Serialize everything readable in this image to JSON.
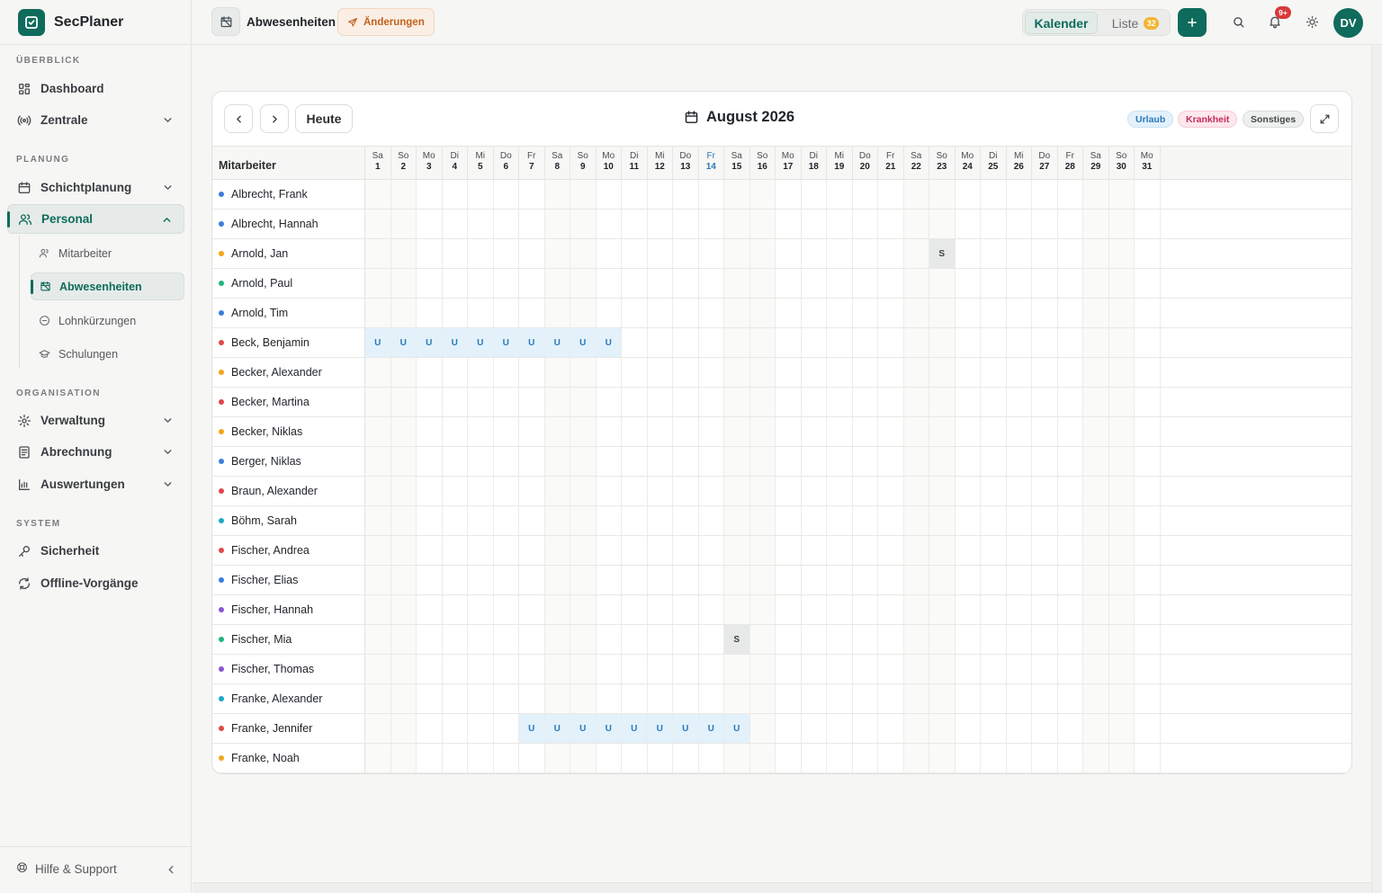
{
  "app": {
    "name": "SecPlaner",
    "help_label": "Hilfe & Support"
  },
  "sidebar": {
    "sections": {
      "overview": "ÜBERBLICK",
      "planning": "PLANUNG",
      "organization": "ORGANISATION",
      "system": "SYSTEM"
    },
    "items": {
      "dashboard": "Dashboard",
      "zentrale": "Zentrale",
      "schichtplanung": "Schichtplanung",
      "personal": "Personal",
      "verwaltung": "Verwaltung",
      "abrechnung": "Abrechnung",
      "auswertungen": "Auswertungen",
      "sicherheit": "Sicherheit",
      "offline": "Offline-Vorgänge"
    },
    "sub_items": {
      "mitarbeiter": "Mitarbeiter",
      "abwesenheiten": "Abwesenheiten",
      "lohnkuerzungen": "Lohnkürzungen",
      "schulungen": "Schulungen"
    }
  },
  "topbar": {
    "page_title": "Abwesenheiten",
    "changes_label": "Änderungen",
    "view_calendar": "Kalender",
    "view_list": "Liste",
    "list_count": "32",
    "notifications_badge": "9+",
    "avatar_initials": "DV"
  },
  "calendar": {
    "today_label": "Heute",
    "month_title": "August 2026",
    "legend": {
      "urlaub": "Urlaub",
      "krankheit": "Krankheit",
      "sonstiges": "Sonstiges"
    },
    "employee_col_label": "Mitarbeiter",
    "today_index": 13,
    "days": [
      {
        "name": "Sa",
        "num": "1",
        "weekend": true
      },
      {
        "name": "So",
        "num": "2",
        "weekend": true
      },
      {
        "name": "Mo",
        "num": "3",
        "weekend": false
      },
      {
        "name": "Di",
        "num": "4",
        "weekend": false
      },
      {
        "name": "Mi",
        "num": "5",
        "weekend": false
      },
      {
        "name": "Do",
        "num": "6",
        "weekend": false
      },
      {
        "name": "Fr",
        "num": "7",
        "weekend": false
      },
      {
        "name": "Sa",
        "num": "8",
        "weekend": true
      },
      {
        "name": "So",
        "num": "9",
        "weekend": true
      },
      {
        "name": "Mo",
        "num": "10",
        "weekend": false
      },
      {
        "name": "Di",
        "num": "11",
        "weekend": false
      },
      {
        "name": "Mi",
        "num": "12",
        "weekend": false
      },
      {
        "name": "Do",
        "num": "13",
        "weekend": false
      },
      {
        "name": "Fr",
        "num": "14",
        "weekend": false
      },
      {
        "name": "Sa",
        "num": "15",
        "weekend": true
      },
      {
        "name": "So",
        "num": "16",
        "weekend": true
      },
      {
        "name": "Mo",
        "num": "17",
        "weekend": false
      },
      {
        "name": "Di",
        "num": "18",
        "weekend": false
      },
      {
        "name": "Mi",
        "num": "19",
        "weekend": false
      },
      {
        "name": "Do",
        "num": "20",
        "weekend": false
      },
      {
        "name": "Fr",
        "num": "21",
        "weekend": false
      },
      {
        "name": "Sa",
        "num": "22",
        "weekend": true
      },
      {
        "name": "So",
        "num": "23",
        "weekend": true
      },
      {
        "name": "Mo",
        "num": "24",
        "weekend": false
      },
      {
        "name": "Di",
        "num": "25",
        "weekend": false
      },
      {
        "name": "Mi",
        "num": "26",
        "weekend": false
      },
      {
        "name": "Do",
        "num": "27",
        "weekend": false
      },
      {
        "name": "Fr",
        "num": "28",
        "weekend": false
      },
      {
        "name": "Sa",
        "num": "29",
        "weekend": true
      },
      {
        "name": "So",
        "num": "30",
        "weekend": true
      },
      {
        "name": "Mo",
        "num": "31",
        "weekend": false
      }
    ],
    "employees": [
      {
        "name": "Albrecht, Frank",
        "color": "#3b7ddd",
        "absences": {}
      },
      {
        "name": "Albrecht, Hannah",
        "color": "#3b7ddd",
        "absences": {}
      },
      {
        "name": "Arnold, Jan",
        "color": "#f2a51a",
        "absences": {
          "23": "S"
        }
      },
      {
        "name": "Arnold, Paul",
        "color": "#1fb57a",
        "absences": {}
      },
      {
        "name": "Arnold, Tim",
        "color": "#3b7ddd",
        "absences": {}
      },
      {
        "name": "Beck, Benjamin",
        "color": "#e04848",
        "absences": {
          "1": "U",
          "2": "U",
          "3": "U",
          "4": "U",
          "5": "U",
          "6": "U",
          "7": "U",
          "8": "U",
          "9": "U",
          "10": "U"
        }
      },
      {
        "name": "Becker, Alexander",
        "color": "#f2a51a",
        "absences": {}
      },
      {
        "name": "Becker, Martina",
        "color": "#e04848",
        "absences": {}
      },
      {
        "name": "Becker, Niklas",
        "color": "#f2a51a",
        "absences": {}
      },
      {
        "name": "Berger, Niklas",
        "color": "#3b7ddd",
        "absences": {}
      },
      {
        "name": "Braun, Alexander",
        "color": "#e04848",
        "absences": {}
      },
      {
        "name": "Böhm, Sarah",
        "color": "#1aa9c9",
        "absences": {}
      },
      {
        "name": "Fischer, Andrea",
        "color": "#e04848",
        "absences": {}
      },
      {
        "name": "Fischer, Elias",
        "color": "#3b7ddd",
        "absences": {}
      },
      {
        "name": "Fischer, Hannah",
        "color": "#8a55d6",
        "absences": {}
      },
      {
        "name": "Fischer, Mia",
        "color": "#1fb57a",
        "absences": {
          "15": "S"
        }
      },
      {
        "name": "Fischer, Thomas",
        "color": "#8a55d6",
        "absences": {}
      },
      {
        "name": "Franke, Alexander",
        "color": "#1aa9c9",
        "absences": {}
      },
      {
        "name": "Franke, Jennifer",
        "color": "#e04848",
        "absences": {
          "7": "U",
          "8": "U",
          "9": "U",
          "10": "U",
          "11": "U",
          "12": "U",
          "13": "U",
          "14": "U",
          "15": "U"
        }
      },
      {
        "name": "Franke, Noah",
        "color": "#f2a51a",
        "absences": {}
      }
    ]
  }
}
